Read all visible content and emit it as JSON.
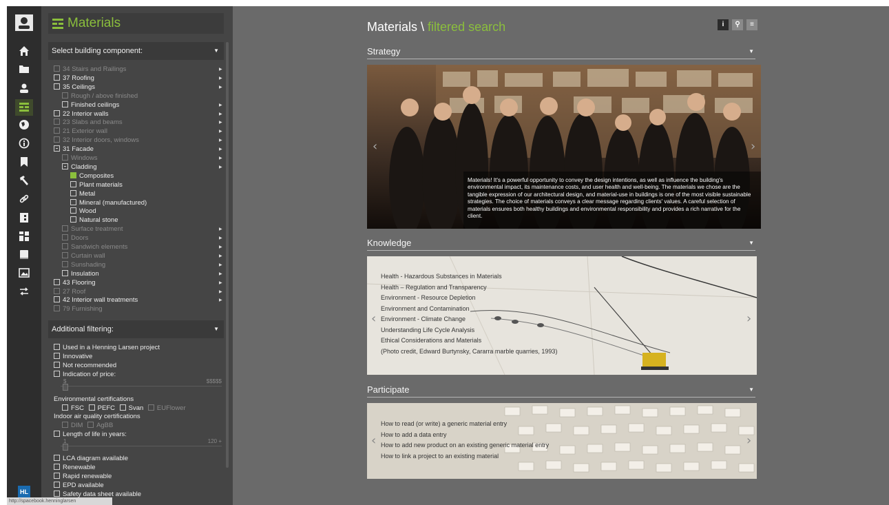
{
  "colors": {
    "accent": "#8bbf3c",
    "background": "#6a6a6a",
    "panel": "#454545",
    "rail": "#2d2d2d"
  },
  "rail": {
    "icons": [
      "user-icon",
      "home-icon",
      "folder-icon",
      "person-icon",
      "materials-icon",
      "globe-icon",
      "info-icon",
      "bookmark-icon",
      "tool-icon",
      "link-icon",
      "logo-b-icon",
      "grid-icon",
      "book-icon",
      "image-icon",
      "exchange-icon",
      "henning-larsen-logo"
    ],
    "logo_text": "HL"
  },
  "panel": {
    "title": "Materials",
    "component_header": "Select building component:",
    "components": [
      {
        "label": "34 Stairs and Railings",
        "dim": true,
        "level": 0,
        "checked": false,
        "arrow": true
      },
      {
        "label": "37 Roofing",
        "dim": false,
        "level": 0,
        "checked": false,
        "arrow": true
      },
      {
        "label": "35 Ceilings",
        "dim": false,
        "level": 0,
        "checked": false,
        "arrow": true
      },
      {
        "label": "Rough / above finished",
        "dim": true,
        "level": 1,
        "checked": false,
        "arrow": false
      },
      {
        "label": "Finished ceilings",
        "dim": false,
        "level": 1,
        "checked": false,
        "arrow": true
      },
      {
        "label": "22 Interior walls",
        "dim": false,
        "level": 0,
        "checked": false,
        "arrow": true
      },
      {
        "label": "23 Slabs and beams",
        "dim": true,
        "level": 0,
        "checked": false,
        "arrow": true
      },
      {
        "label": "21 Exterior wall",
        "dim": true,
        "level": 0,
        "checked": false,
        "arrow": true
      },
      {
        "label": "32 Interior doors, windows",
        "dim": true,
        "level": 0,
        "checked": false,
        "arrow": true
      },
      {
        "label": "31 Facade",
        "dim": false,
        "level": 0,
        "checked": false,
        "arrow": true,
        "partial": true
      },
      {
        "label": "Windows",
        "dim": true,
        "level": 1,
        "checked": false,
        "arrow": true
      },
      {
        "label": "Cladding",
        "dim": false,
        "level": 1,
        "checked": false,
        "arrow": true,
        "partial": true
      },
      {
        "label": "Composites",
        "dim": false,
        "level": 2,
        "checked": true,
        "arrow": false
      },
      {
        "label": "Plant materials",
        "dim": false,
        "level": 2,
        "checked": false,
        "arrow": false
      },
      {
        "label": "Metal",
        "dim": false,
        "level": 2,
        "checked": false,
        "arrow": false
      },
      {
        "label": "Mineral (manufactured)",
        "dim": false,
        "level": 2,
        "checked": false,
        "arrow": false
      },
      {
        "label": "Wood",
        "dim": false,
        "level": 2,
        "checked": false,
        "arrow": false
      },
      {
        "label": "Natural stone",
        "dim": false,
        "level": 2,
        "checked": false,
        "arrow": false
      },
      {
        "label": "Surface treatment",
        "dim": true,
        "level": 1,
        "checked": false,
        "arrow": true
      },
      {
        "label": "Doors",
        "dim": true,
        "level": 1,
        "checked": false,
        "arrow": true
      },
      {
        "label": "Sandwich elements",
        "dim": true,
        "level": 1,
        "checked": false,
        "arrow": true
      },
      {
        "label": "Curtain wall",
        "dim": true,
        "level": 1,
        "checked": false,
        "arrow": true
      },
      {
        "label": "Sunshading",
        "dim": true,
        "level": 1,
        "checked": false,
        "arrow": true
      },
      {
        "label": "Insulation",
        "dim": false,
        "level": 1,
        "checked": false,
        "arrow": true
      },
      {
        "label": "43 Flooring",
        "dim": false,
        "level": 0,
        "checked": false,
        "arrow": true
      },
      {
        "label": "27 Roof",
        "dim": true,
        "level": 0,
        "checked": false,
        "arrow": true
      },
      {
        "label": "42 Interior wall treatments",
        "dim": false,
        "level": 0,
        "checked": false,
        "arrow": true
      },
      {
        "label": "79 Furnishing",
        "dim": true,
        "level": 0,
        "checked": false,
        "arrow": false
      }
    ],
    "additional_header": "Additional filtering:",
    "filters_top": [
      "Used in a Henning Larsen project",
      "Innovative",
      "Not recommended",
      "Indication of price:"
    ],
    "price_min": "$",
    "price_max": "$$$$$",
    "env_cert_label": "Environmental certifications",
    "env_certs": [
      {
        "label": "FSC",
        "dim": false
      },
      {
        "label": "PEFC",
        "dim": false
      },
      {
        "label": "Svan",
        "dim": false
      },
      {
        "label": "EUFlower",
        "dim": true
      }
    ],
    "indoor_label": "Indoor air quality certifications",
    "indoor_certs": [
      {
        "label": "DIM",
        "dim": true
      },
      {
        "label": "AgBB",
        "dim": true
      }
    ],
    "life_label": "Length of life in years:",
    "life_min": "1",
    "life_max": "120 +",
    "filters_bottom": [
      "LCA diagram available",
      "Renewable",
      "Rapid renewable",
      "EPD available",
      "Safety data sheet available"
    ]
  },
  "main": {
    "title_prefix": "Materials \\",
    "title_suffix": "filtered search",
    "tool_info": "i",
    "tool_search": "⚲",
    "tool_menu": "≡",
    "strategy": {
      "title": "Strategy",
      "caption": "Materials! It's a powerful opportunity to convey the design intentions, as well as influence the building's environmental impact, its maintenance costs, and user health and well-being. The materials we chose are the tangible expression of our architectural design, and material-use in buildings is one of the most visible sustainable strategies. The choice of materials conveys a clear message regarding clients' values. A careful selection of materials ensures both healthy buildings and environmental responsibility and provides a rich narrative for the client."
    },
    "knowledge": {
      "title": "Knowledge",
      "links": [
        "Health - Hazardous Substances in Materials",
        "Health – Regulation and Transparency",
        "Environment - Resource Depletion",
        "Environment and Contamination",
        "Environment - Climate Change",
        "Understanding Life Cycle Analysis",
        "Ethical Considerations and Materials",
        "(Photo credit, Edward Burtynsky, Cararra marble quarries, 1993)"
      ]
    },
    "participate": {
      "title": "Participate",
      "links": [
        "How to read (or write) a generic material entry",
        "How to add a data entry",
        "How to add new product on an existing generic material entry",
        "How to link a project to an existing material"
      ]
    }
  },
  "status_bar": "http://spacebook.henninglarsen"
}
